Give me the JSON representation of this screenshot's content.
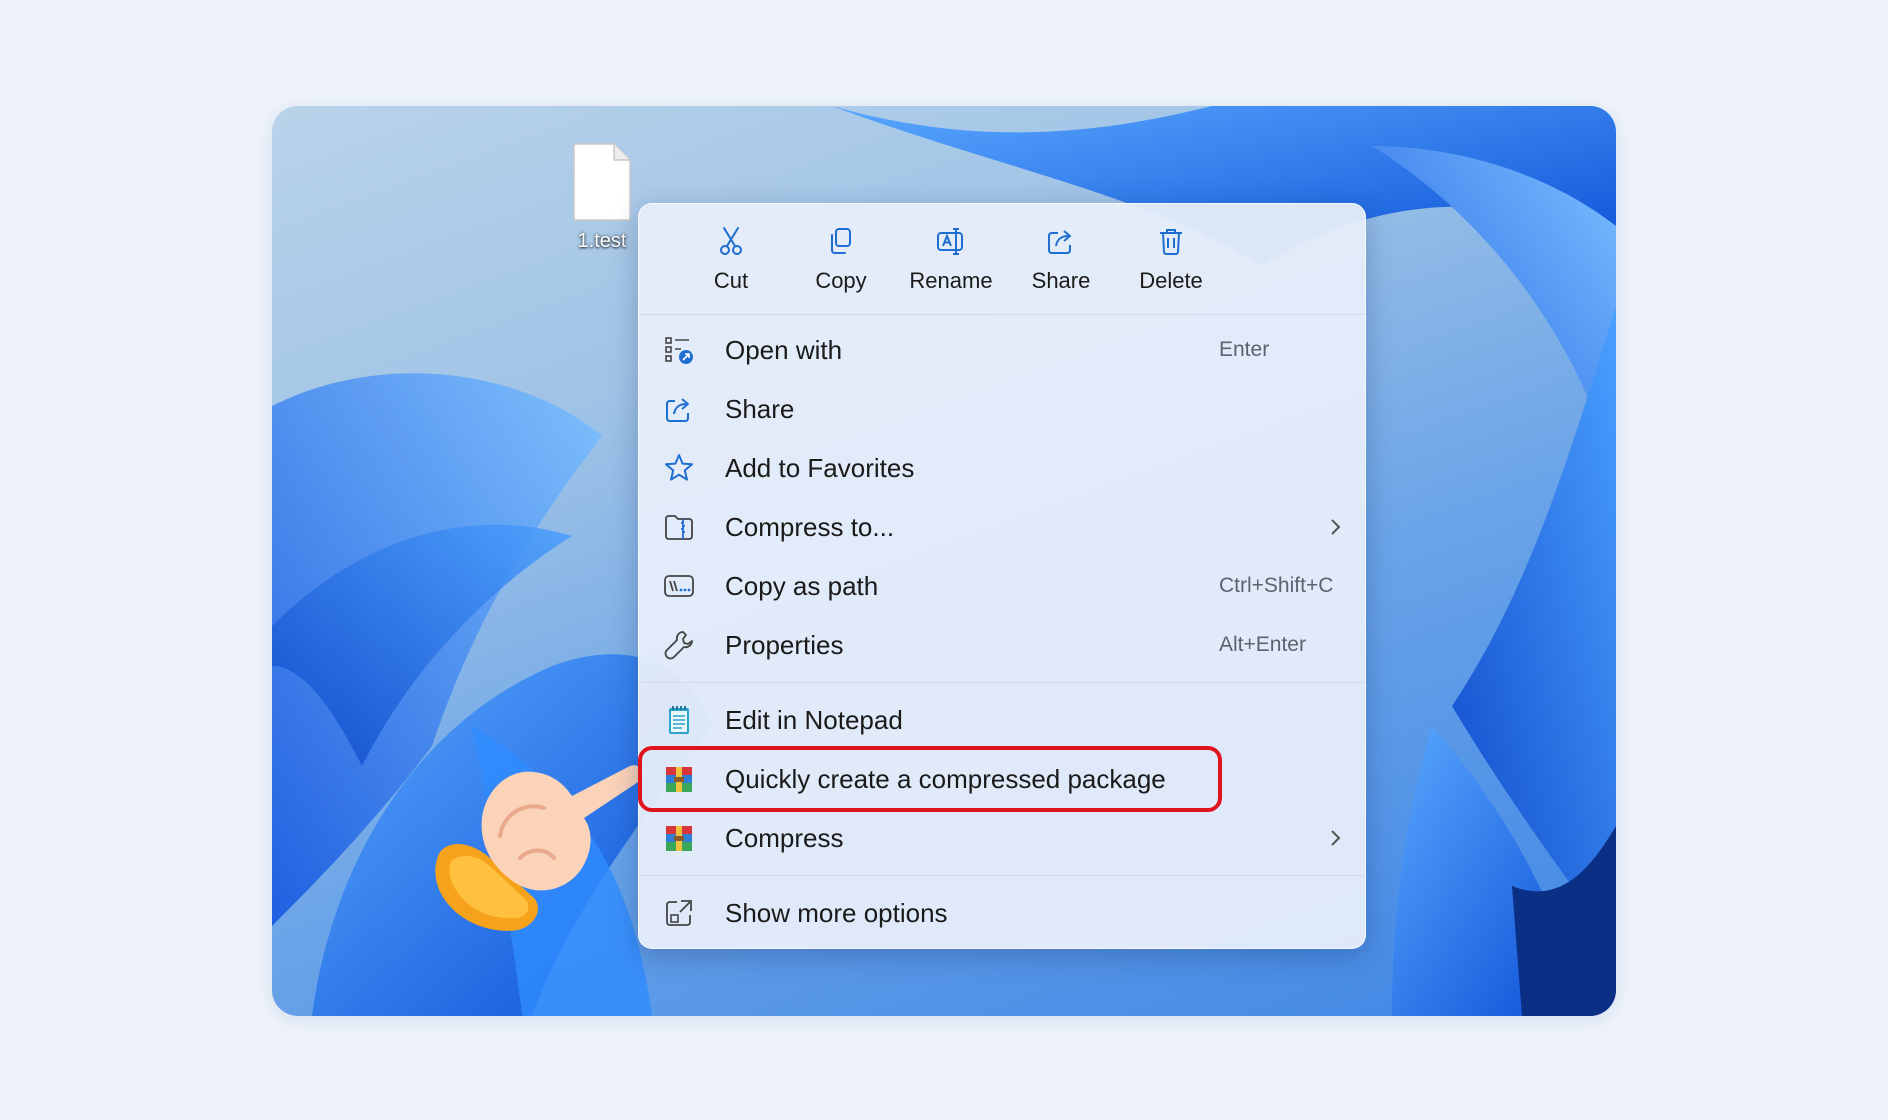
{
  "desktop": {
    "file": {
      "name": "1.test",
      "icon": "document-icon"
    }
  },
  "context_menu": {
    "toolbar": [
      {
        "label": "Cut",
        "icon": "scissors-icon"
      },
      {
        "label": "Copy",
        "icon": "copy-icon"
      },
      {
        "label": "Rename",
        "icon": "rename-icon"
      },
      {
        "label": "Share",
        "icon": "share-icon"
      },
      {
        "label": "Delete",
        "icon": "trash-icon"
      }
    ],
    "items": [
      {
        "label": "Open with",
        "shortcut": "Enter",
        "icon": "open-with-icon"
      },
      {
        "label": "Share",
        "shortcut": "",
        "icon": "share-icon"
      },
      {
        "label": "Add to Favorites",
        "shortcut": "",
        "icon": "star-icon"
      },
      {
        "label": "Compress to...",
        "shortcut": "",
        "icon": "zip-folder-icon",
        "submenu": true
      },
      {
        "label": "Copy as path",
        "shortcut": "Ctrl+Shift+C",
        "icon": "path-icon"
      },
      {
        "label": "Properties",
        "shortcut": "Alt+Enter",
        "icon": "wrench-icon"
      },
      {
        "label": "Edit in Notepad",
        "shortcut": "",
        "icon": "notepad-icon"
      },
      {
        "label": "Quickly create a compressed package",
        "shortcut": "",
        "icon": "archive-app-icon",
        "highlighted": true
      },
      {
        "label": "Compress",
        "shortcut": "",
        "icon": "archive-app-icon",
        "submenu": true
      },
      {
        "label": "Show more options",
        "shortcut": "",
        "icon": "more-options-icon"
      }
    ]
  },
  "colors": {
    "highlight_border": "#e0141f",
    "icon_blue": "#1f6fd1",
    "wallpaper_blue": "#1e6cf0"
  }
}
